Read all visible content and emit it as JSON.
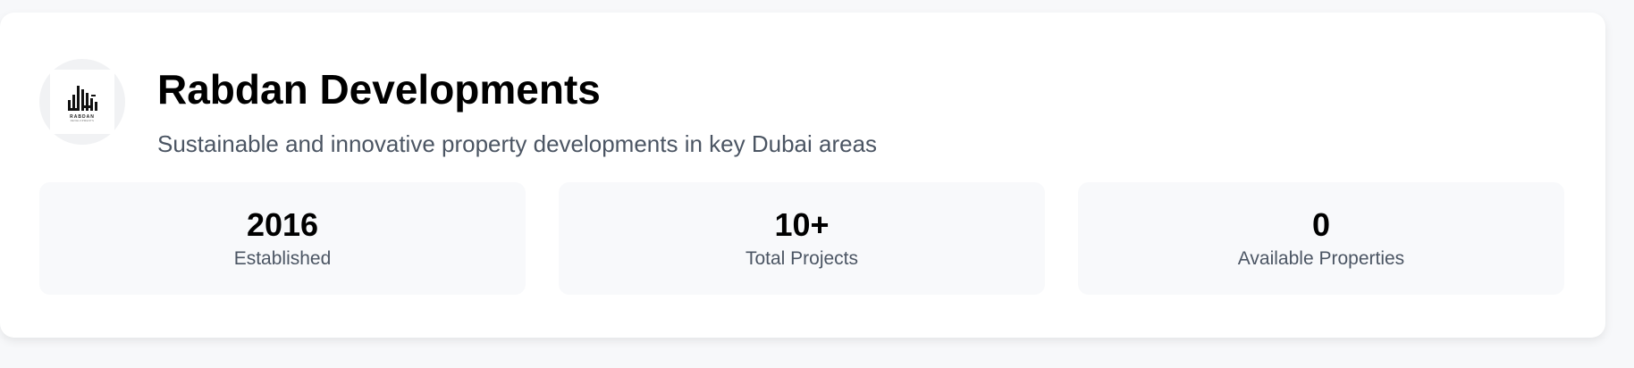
{
  "developer": {
    "logo_icon": "building-logo-icon",
    "logo_text": "RABDAN",
    "logo_subtext": "DEVELOPMENTS",
    "name": "Rabdan Developments",
    "description": "Sustainable and innovative property developments in key Dubai areas"
  },
  "stats": [
    {
      "value": "2016",
      "label": "Established"
    },
    {
      "value": "10+",
      "label": "Total Projects"
    },
    {
      "value": "0",
      "label": "Available Properties"
    }
  ],
  "colors": {
    "page_bg": "#f7f8fa",
    "card_bg": "#ffffff",
    "stat_bg": "#f8f9fb",
    "title": "#000000",
    "muted_text": "#4b5563"
  }
}
